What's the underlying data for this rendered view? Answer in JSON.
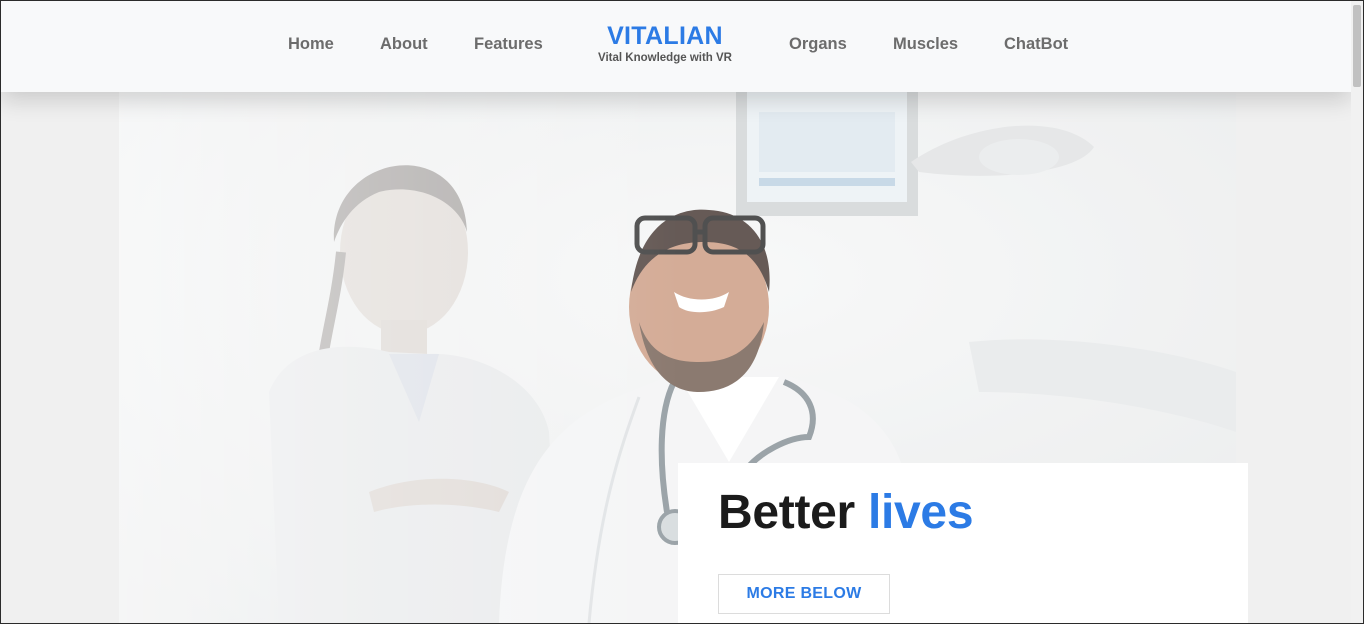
{
  "colors": {
    "accent": "#2c7be5",
    "nav_text": "#6c6c6c",
    "heading": "#1b1b1b",
    "navbar_bg": "#f8f9fa",
    "page_bg": "#f0f0f0"
  },
  "nav": {
    "left_links": [
      {
        "label": "Home"
      },
      {
        "label": "About"
      },
      {
        "label": "Features"
      }
    ],
    "brand": {
      "title": "VITALIAN",
      "subtitle": "Vital Knowledge with VR"
    },
    "right_links": [
      {
        "label": "Organs"
      },
      {
        "label": "Muscles"
      },
      {
        "label": "ChatBot"
      }
    ]
  },
  "hero": {
    "image": "doctors-photo",
    "heading_main": "Better",
    "heading_accent": "lives",
    "button_label": "MORE BELOW"
  }
}
